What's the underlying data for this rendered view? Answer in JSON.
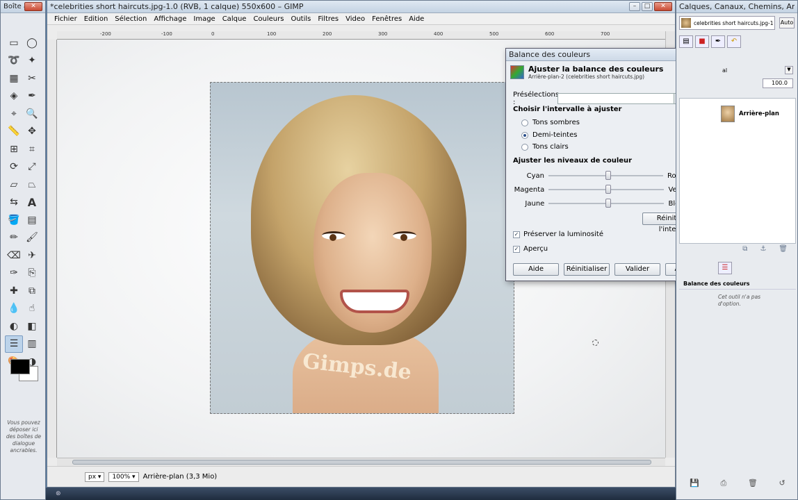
{
  "toolbox": {
    "title": "Boîte à",
    "drop_note": "Vous pouvez déposer ici des boîtes de dialogue ancrables."
  },
  "image_window": {
    "title": "*celebrities short haircuts.jpg-1.0 (RVB, 1 calque) 550x600 – GIMP",
    "menu": [
      "Fichier",
      "Edition",
      "Sélection",
      "Affichage",
      "Image",
      "Calque",
      "Couleurs",
      "Outils",
      "Filtres",
      "Video",
      "Fenêtres",
      "Aide"
    ],
    "ruler_ticks": [
      "-200",
      "-100",
      "0",
      "100",
      "200",
      "300",
      "400",
      "500",
      "600",
      "700"
    ],
    "watermark": "Gimps.de",
    "status": {
      "unit": "px",
      "zoom": "100%",
      "layer_info": "Arrière-plan (3,3 Mio)"
    }
  },
  "dialog": {
    "title": "Balance des couleurs",
    "header_title": "Ajuster la balance des couleurs",
    "header_subtitle": "Arrière-plan-2 (celebrities short haircuts.jpg)",
    "presets_label": "Présélections :",
    "range_title": "Choisir l'intervalle à ajuster",
    "ranges": [
      "Tons sombres",
      "Demi-teintes",
      "Tons clairs"
    ],
    "selected_range": "Demi-teintes",
    "levels_title": "Ajuster les niveaux de couleur",
    "sliders": [
      {
        "left": "Cyan",
        "right": "Rouge",
        "value": "0"
      },
      {
        "left": "Magenta",
        "right": "Vert",
        "value": "0"
      },
      {
        "left": "Jaune",
        "right": "Bleu",
        "value": "0"
      }
    ],
    "reset_range": "Réinitialiser l'intervalle",
    "preserve": "Préserver la luminosité",
    "preview": "Aperçu",
    "buttons": {
      "help": "Aide",
      "reset": "Réinitialiser",
      "ok": "Valider",
      "cancel": "Annuler"
    }
  },
  "dock": {
    "title": "Calques, Canaux, Chemins, Annuler...",
    "image_name": "celebrities short haircuts.jpg-1",
    "auto": "Auto",
    "mode_value": "al",
    "opacity": "100.0",
    "layer_name": "Arrière-plan",
    "options_title": "Balance des couleurs",
    "options_note": "Cet outil n'a pas d'option."
  }
}
